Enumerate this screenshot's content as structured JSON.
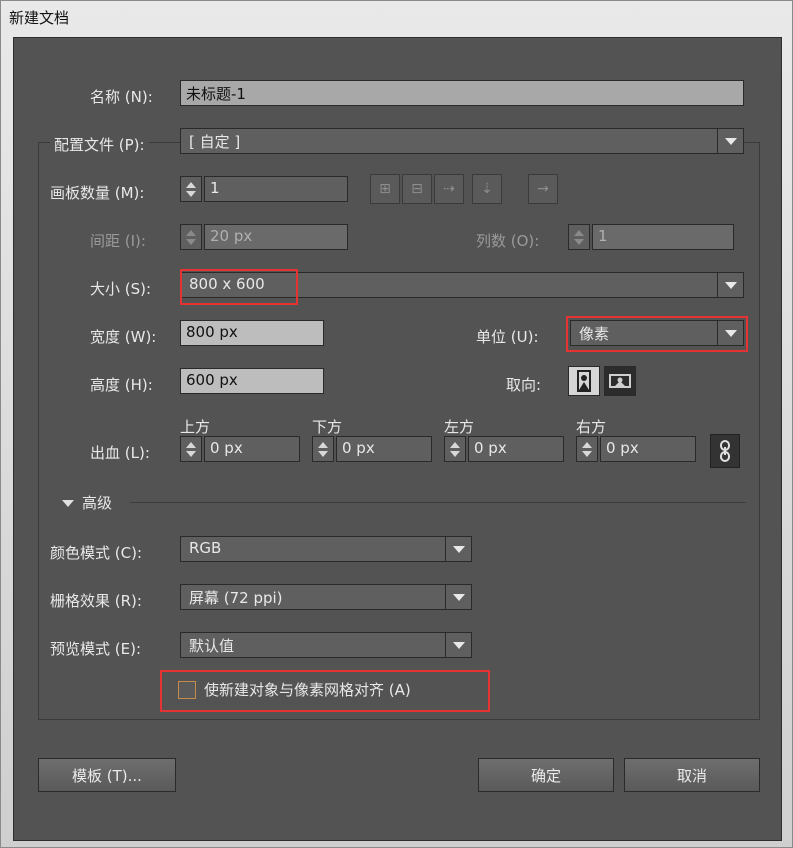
{
  "window": {
    "title": "新建文档"
  },
  "name": {
    "label": "名称 (N):",
    "value": "未标题-1"
  },
  "profile": {
    "label": "配置文件 (P):",
    "value": "[ 自定 ]"
  },
  "artboards": {
    "label": "画板数量 (M):",
    "value": "1"
  },
  "spacing": {
    "label": "间距 (I):",
    "value": "20 px"
  },
  "columns": {
    "label": "列数 (O):",
    "value": "1"
  },
  "size": {
    "label": "大小 (S):",
    "value": "800 x 600"
  },
  "width": {
    "label": "宽度 (W):",
    "value": "800 px"
  },
  "units": {
    "label": "单位 (U):",
    "value": "像素"
  },
  "height": {
    "label": "高度 (H):",
    "value": "600 px"
  },
  "orientation": {
    "label": "取向:"
  },
  "bleed": {
    "label": "出血 (L):",
    "top": {
      "label": "上方",
      "value": "0 px"
    },
    "bottom": {
      "label": "下方",
      "value": "0 px"
    },
    "left": {
      "label": "左方",
      "value": "0 px"
    },
    "right": {
      "label": "右方",
      "value": "0 px"
    }
  },
  "advanced": {
    "label": "高级"
  },
  "color_mode": {
    "label": "颜色模式 (C):",
    "value": "RGB"
  },
  "raster": {
    "label": "栅格效果 (R):",
    "value": "屏幕 (72 ppi)"
  },
  "preview": {
    "label": "预览模式 (E):",
    "value": "默认值"
  },
  "align_pixel": {
    "label": "使新建对象与像素网格对齐 (A)",
    "checked": false
  },
  "buttons": {
    "templates": "模板 (T)...",
    "ok": "确定",
    "cancel": "取消"
  },
  "colors": {
    "dialog_bg": "#535353",
    "highlight": "#e53333",
    "checkbox_border": "#c68b4a"
  }
}
